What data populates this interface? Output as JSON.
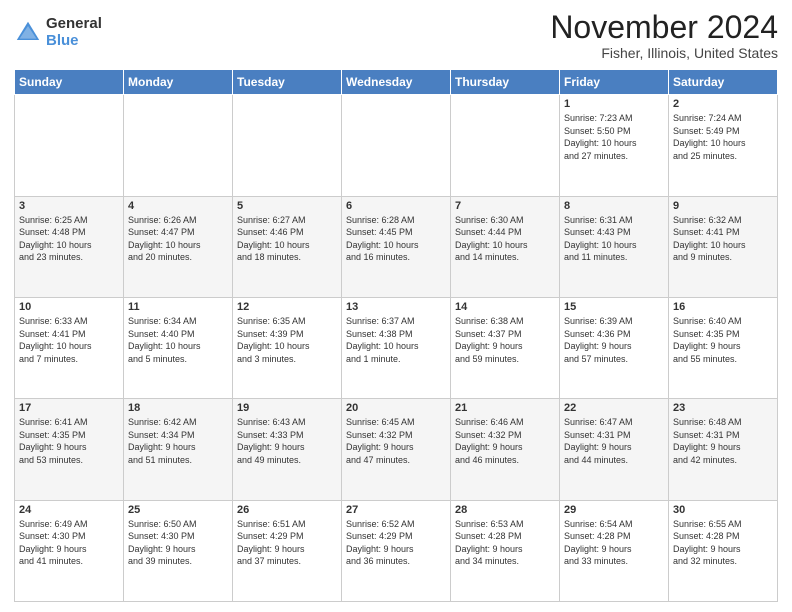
{
  "header": {
    "logo": {
      "general": "General",
      "blue": "Blue"
    },
    "title": "November 2024",
    "location": "Fisher, Illinois, United States"
  },
  "weekdays": [
    "Sunday",
    "Monday",
    "Tuesday",
    "Wednesday",
    "Thursday",
    "Friday",
    "Saturday"
  ],
  "weeks": [
    [
      {
        "day": "",
        "info": ""
      },
      {
        "day": "",
        "info": ""
      },
      {
        "day": "",
        "info": ""
      },
      {
        "day": "",
        "info": ""
      },
      {
        "day": "",
        "info": ""
      },
      {
        "day": "1",
        "info": "Sunrise: 7:23 AM\nSunset: 5:50 PM\nDaylight: 10 hours\nand 27 minutes."
      },
      {
        "day": "2",
        "info": "Sunrise: 7:24 AM\nSunset: 5:49 PM\nDaylight: 10 hours\nand 25 minutes."
      }
    ],
    [
      {
        "day": "3",
        "info": "Sunrise: 6:25 AM\nSunset: 4:48 PM\nDaylight: 10 hours\nand 23 minutes."
      },
      {
        "day": "4",
        "info": "Sunrise: 6:26 AM\nSunset: 4:47 PM\nDaylight: 10 hours\nand 20 minutes."
      },
      {
        "day": "5",
        "info": "Sunrise: 6:27 AM\nSunset: 4:46 PM\nDaylight: 10 hours\nand 18 minutes."
      },
      {
        "day": "6",
        "info": "Sunrise: 6:28 AM\nSunset: 4:45 PM\nDaylight: 10 hours\nand 16 minutes."
      },
      {
        "day": "7",
        "info": "Sunrise: 6:30 AM\nSunset: 4:44 PM\nDaylight: 10 hours\nand 14 minutes."
      },
      {
        "day": "8",
        "info": "Sunrise: 6:31 AM\nSunset: 4:43 PM\nDaylight: 10 hours\nand 11 minutes."
      },
      {
        "day": "9",
        "info": "Sunrise: 6:32 AM\nSunset: 4:41 PM\nDaylight: 10 hours\nand 9 minutes."
      }
    ],
    [
      {
        "day": "10",
        "info": "Sunrise: 6:33 AM\nSunset: 4:41 PM\nDaylight: 10 hours\nand 7 minutes."
      },
      {
        "day": "11",
        "info": "Sunrise: 6:34 AM\nSunset: 4:40 PM\nDaylight: 10 hours\nand 5 minutes."
      },
      {
        "day": "12",
        "info": "Sunrise: 6:35 AM\nSunset: 4:39 PM\nDaylight: 10 hours\nand 3 minutes."
      },
      {
        "day": "13",
        "info": "Sunrise: 6:37 AM\nSunset: 4:38 PM\nDaylight: 10 hours\nand 1 minute."
      },
      {
        "day": "14",
        "info": "Sunrise: 6:38 AM\nSunset: 4:37 PM\nDaylight: 9 hours\nand 59 minutes."
      },
      {
        "day": "15",
        "info": "Sunrise: 6:39 AM\nSunset: 4:36 PM\nDaylight: 9 hours\nand 57 minutes."
      },
      {
        "day": "16",
        "info": "Sunrise: 6:40 AM\nSunset: 4:35 PM\nDaylight: 9 hours\nand 55 minutes."
      }
    ],
    [
      {
        "day": "17",
        "info": "Sunrise: 6:41 AM\nSunset: 4:35 PM\nDaylight: 9 hours\nand 53 minutes."
      },
      {
        "day": "18",
        "info": "Sunrise: 6:42 AM\nSunset: 4:34 PM\nDaylight: 9 hours\nand 51 minutes."
      },
      {
        "day": "19",
        "info": "Sunrise: 6:43 AM\nSunset: 4:33 PM\nDaylight: 9 hours\nand 49 minutes."
      },
      {
        "day": "20",
        "info": "Sunrise: 6:45 AM\nSunset: 4:32 PM\nDaylight: 9 hours\nand 47 minutes."
      },
      {
        "day": "21",
        "info": "Sunrise: 6:46 AM\nSunset: 4:32 PM\nDaylight: 9 hours\nand 46 minutes."
      },
      {
        "day": "22",
        "info": "Sunrise: 6:47 AM\nSunset: 4:31 PM\nDaylight: 9 hours\nand 44 minutes."
      },
      {
        "day": "23",
        "info": "Sunrise: 6:48 AM\nSunset: 4:31 PM\nDaylight: 9 hours\nand 42 minutes."
      }
    ],
    [
      {
        "day": "24",
        "info": "Sunrise: 6:49 AM\nSunset: 4:30 PM\nDaylight: 9 hours\nand 41 minutes."
      },
      {
        "day": "25",
        "info": "Sunrise: 6:50 AM\nSunset: 4:30 PM\nDaylight: 9 hours\nand 39 minutes."
      },
      {
        "day": "26",
        "info": "Sunrise: 6:51 AM\nSunset: 4:29 PM\nDaylight: 9 hours\nand 37 minutes."
      },
      {
        "day": "27",
        "info": "Sunrise: 6:52 AM\nSunset: 4:29 PM\nDaylight: 9 hours\nand 36 minutes."
      },
      {
        "day": "28",
        "info": "Sunrise: 6:53 AM\nSunset: 4:28 PM\nDaylight: 9 hours\nand 34 minutes."
      },
      {
        "day": "29",
        "info": "Sunrise: 6:54 AM\nSunset: 4:28 PM\nDaylight: 9 hours\nand 33 minutes."
      },
      {
        "day": "30",
        "info": "Sunrise: 6:55 AM\nSunset: 4:28 PM\nDaylight: 9 hours\nand 32 minutes."
      }
    ]
  ]
}
